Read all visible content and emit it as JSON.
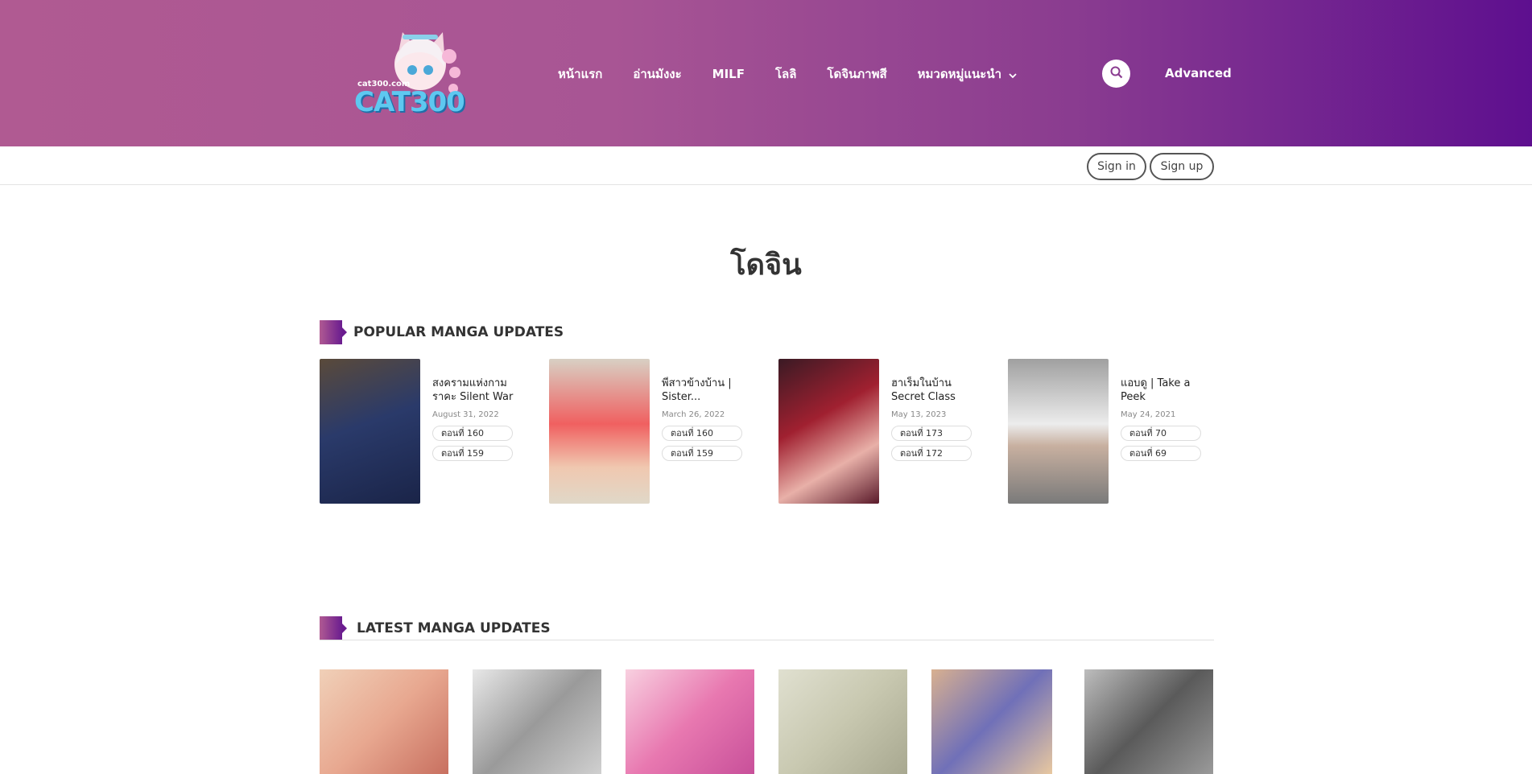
{
  "header": {
    "logo_domain": "cat300.com",
    "logo_text": "CAT300",
    "nav": [
      {
        "label": "หน้าแรก"
      },
      {
        "label": "อ่านมังงะ"
      },
      {
        "label": "MILF"
      },
      {
        "label": "โลลิ"
      },
      {
        "label": "โดจินภาพสี"
      },
      {
        "label": "หมวดหมู่แนะนำ"
      }
    ],
    "search_icon": "search-icon",
    "advanced_label": "Advanced"
  },
  "auth": {
    "signin_label": "Sign in",
    "signup_label": "Sign up"
  },
  "page": {
    "title": "โดจิน"
  },
  "popular": {
    "heading": "POPULAR MANGA UPDATES",
    "items": [
      {
        "title": "สงครามแห่งกามราคะ Silent War",
        "date": "August 31, 2022",
        "chapters": [
          "ตอนที่ 160",
          "ตอนที่ 159"
        ],
        "color": "#2a3a6a"
      },
      {
        "title": "พี่สาวข้างบ้าน | Sister...",
        "date": "March 26, 2022",
        "chapters": [
          "ตอนที่ 160",
          "ตอนที่ 159"
        ],
        "color": "#e8a0a0"
      },
      {
        "title": "ฮาเร็มในบ้าน Secret Class",
        "date": "May 13, 2023",
        "chapters": [
          "ตอนที่ 173",
          "ตอนที่ 172"
        ],
        "color": "#8a1c2a"
      },
      {
        "title": "แอบดู | Take a Peek",
        "date": "May 24, 2021",
        "chapters": [
          "ตอนที่ 70",
          "ตอนที่ 69"
        ],
        "color": "#8a8a8a"
      }
    ]
  },
  "latest": {
    "heading": "LATEST MANGA UPDATES",
    "covers": [
      {
        "color": "#e8b8a0"
      },
      {
        "color": "#bbbbbb"
      },
      {
        "color": "#f0a8c8"
      },
      {
        "color": "#d8d8c0"
      },
      {
        "color": "#c89878"
      },
      {
        "color": "#777777"
      }
    ]
  }
}
